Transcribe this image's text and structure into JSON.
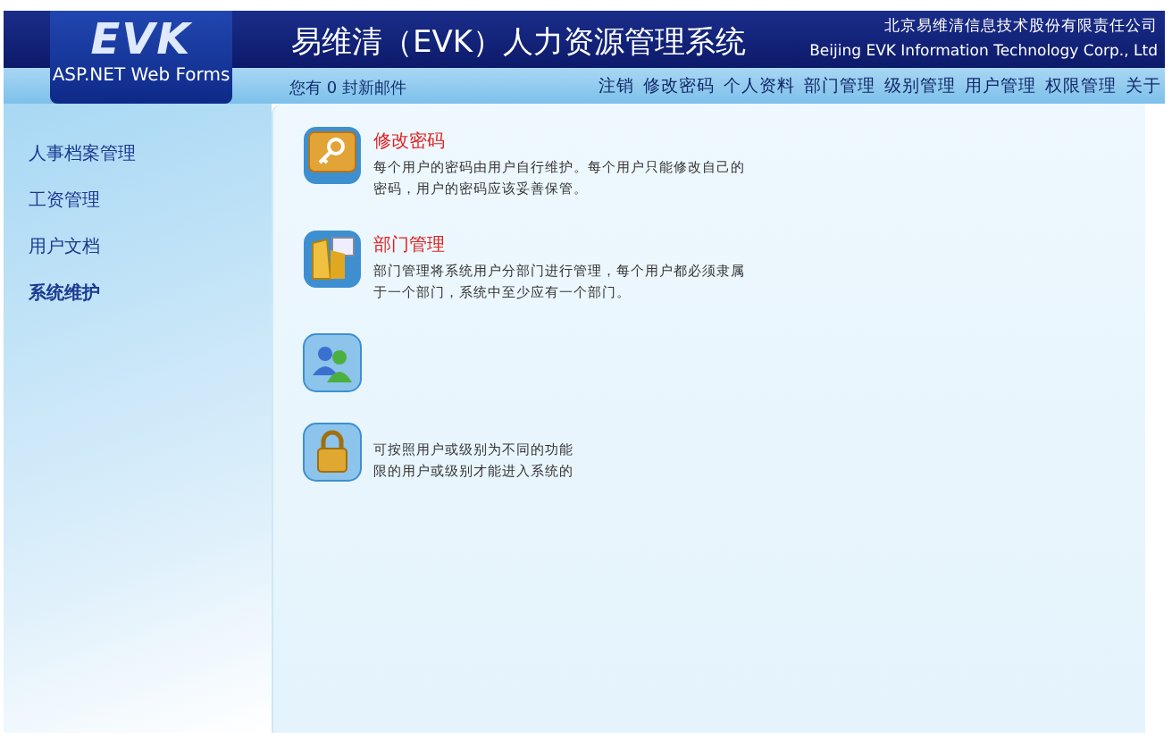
{
  "logo": {
    "title": "EVK",
    "subtitle": "ASP.NET Web Forms"
  },
  "header": {
    "title": "易维清（EVK）人力资源管理系统",
    "company_cn": "北京易维清信息技术股份有限责任公司",
    "company_en": "Beijing EVK Information Technology Corp., Ltd"
  },
  "mail_notice": "您有 0 封新邮件",
  "nav": [
    "注销",
    "修改密码",
    "个人资料",
    "部门管理",
    "级别管理",
    "用户管理",
    "权限管理",
    "关于"
  ],
  "sidebar": {
    "items": [
      {
        "label": "人事档案管理",
        "selected": false
      },
      {
        "label": "工资管理",
        "selected": false
      },
      {
        "label": "用户文档",
        "selected": false
      },
      {
        "label": "系统维护",
        "selected": true
      }
    ]
  },
  "modules": [
    {
      "kind": "key",
      "title": "修改密码",
      "lines": [
        "每个用户的密码由用户自行维护。每个用户只能修改自己的",
        "密码，用户的密码应该妥善保管。"
      ]
    },
    {
      "kind": "folder",
      "title": "部门管理",
      "lines": [
        "部门管理将系统用户分部门进行管理，每个用户都必须隶属",
        "于一个部门，系统中至少应有一个部门。"
      ]
    },
    {
      "kind": "users"
    },
    {
      "kind": "lock",
      "lines": [
        "可按照用户或级别为不同的功能",
        "限的用户或级别才能进入系统的"
      ]
    }
  ]
}
